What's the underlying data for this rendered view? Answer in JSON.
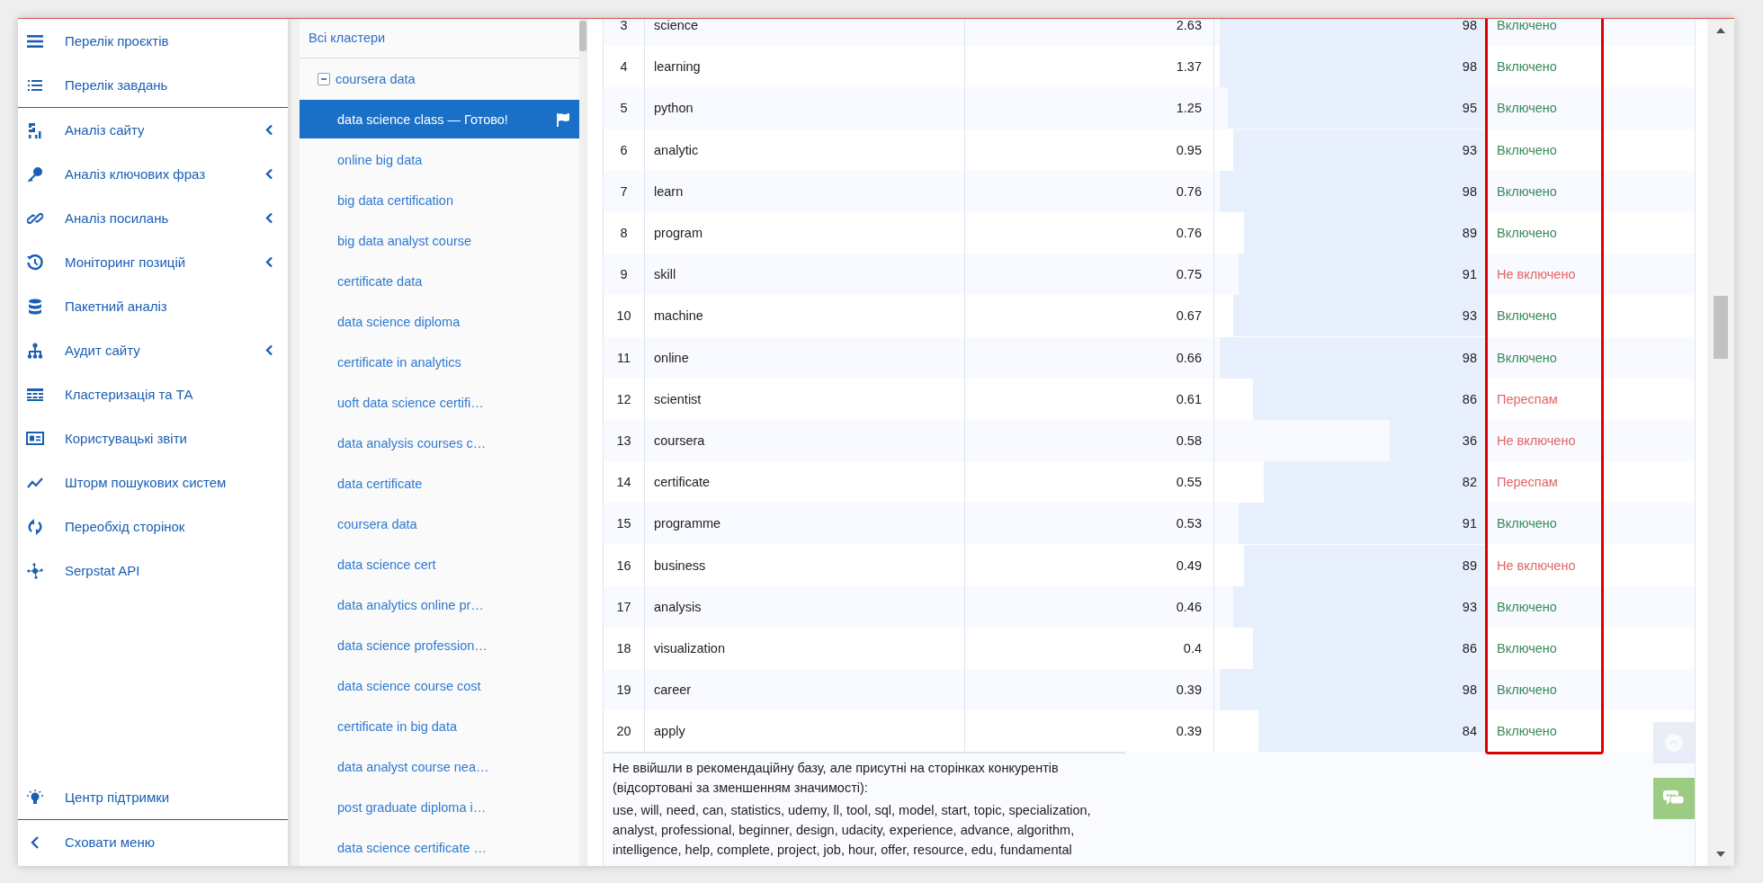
{
  "sidebar": {
    "sections": [
      {
        "items": [
          {
            "label": "Перелік проєктів",
            "has_submenu": false
          },
          {
            "label": "Перелік завдань",
            "has_submenu": false
          }
        ]
      },
      {
        "items": [
          {
            "label": "Аналіз сайту",
            "has_submenu": true
          },
          {
            "label": "Аналіз ключових фраз",
            "has_submenu": true
          },
          {
            "label": "Аналіз посилань",
            "has_submenu": true
          },
          {
            "label": "Моніторинг позицій",
            "has_submenu": true
          },
          {
            "label": "Пакетний аналіз",
            "has_submenu": false
          },
          {
            "label": "Аудит сайту",
            "has_submenu": true
          },
          {
            "label": "Кластеризація та ТА",
            "has_submenu": false
          },
          {
            "label": "Користувацькі звіти",
            "has_submenu": false
          },
          {
            "label": "Шторм пошукових систем",
            "has_submenu": false
          },
          {
            "label": "Переобхід сторінок",
            "has_submenu": false
          },
          {
            "label": "Serpstat API",
            "has_submenu": false
          }
        ]
      }
    ],
    "footer": [
      {
        "label": "Центр підтримки"
      },
      {
        "label": "Сховати меню"
      }
    ]
  },
  "clusters": {
    "header": "Всі кластери",
    "tree": [
      {
        "label": "coursera data",
        "expanded": true,
        "children": [
          {
            "label": "data science class — Готово!",
            "selected": true
          },
          {
            "label": "online big data",
            "selected": false
          },
          {
            "label": "big data certification",
            "selected": false
          },
          {
            "label": "big data analyst course",
            "selected": false
          },
          {
            "label": "certificate data",
            "selected": false
          },
          {
            "label": "data science diploma",
            "selected": false
          },
          {
            "label": "certificate in analytics",
            "selected": false
          },
          {
            "label": "uoft data science certifi…",
            "selected": false
          },
          {
            "label": "data analysis courses c…",
            "selected": false
          },
          {
            "label": "data certificate",
            "selected": false
          },
          {
            "label": "coursera data",
            "selected": false
          },
          {
            "label": "data science cert",
            "selected": false
          },
          {
            "label": "data analytics online pr…",
            "selected": false
          },
          {
            "label": "data science profession…",
            "selected": false
          },
          {
            "label": "data science course cost",
            "selected": false
          },
          {
            "label": "certificate in big data",
            "selected": false
          },
          {
            "label": "data analyst course nea…",
            "selected": false
          },
          {
            "label": "post graduate diploma i…",
            "selected": false
          },
          {
            "label": "data science certificate …",
            "selected": false
          }
        ]
      }
    ]
  },
  "table": {
    "rows": [
      {
        "num": "3",
        "word": "science",
        "value": "2.63",
        "score": "98",
        "level": 0.98,
        "status": "Включено",
        "kind": "included"
      },
      {
        "num": "4",
        "word": "learning",
        "value": "1.37",
        "score": "98",
        "level": 0.98,
        "status": "Включено",
        "kind": "included"
      },
      {
        "num": "5",
        "word": "python",
        "value": "1.25",
        "score": "95",
        "level": 0.95,
        "status": "Включено",
        "kind": "included"
      },
      {
        "num": "6",
        "word": "analytic",
        "value": "0.95",
        "score": "93",
        "level": 0.93,
        "status": "Включено",
        "kind": "included"
      },
      {
        "num": "7",
        "word": "learn",
        "value": "0.76",
        "score": "98",
        "level": 0.98,
        "status": "Включено",
        "kind": "included"
      },
      {
        "num": "8",
        "word": "program",
        "value": "0.76",
        "score": "89",
        "level": 0.89,
        "status": "Включено",
        "kind": "included"
      },
      {
        "num": "9",
        "word": "skill",
        "value": "0.75",
        "score": "91",
        "level": 0.91,
        "status": "Не включено",
        "kind": "excluded"
      },
      {
        "num": "10",
        "word": "machine",
        "value": "0.67",
        "score": "93",
        "level": 0.93,
        "status": "Включено",
        "kind": "included"
      },
      {
        "num": "11",
        "word": "online",
        "value": "0.66",
        "score": "98",
        "level": 0.98,
        "status": "Включено",
        "kind": "included"
      },
      {
        "num": "12",
        "word": "scientist",
        "value": "0.61",
        "score": "86",
        "level": 0.86,
        "status": "Переспам",
        "kind": "spam"
      },
      {
        "num": "13",
        "word": "coursera",
        "value": "0.58",
        "score": "36",
        "level": 0.36,
        "status": "Не включено",
        "kind": "excluded"
      },
      {
        "num": "14",
        "word": "certificate",
        "value": "0.55",
        "score": "82",
        "level": 0.82,
        "status": "Переспам",
        "kind": "spam"
      },
      {
        "num": "15",
        "word": "programme",
        "value": "0.53",
        "score": "91",
        "level": 0.91,
        "status": "Включено",
        "kind": "included"
      },
      {
        "num": "16",
        "word": "business",
        "value": "0.49",
        "score": "89",
        "level": 0.89,
        "status": "Не включено",
        "kind": "excluded"
      },
      {
        "num": "17",
        "word": "analysis",
        "value": "0.46",
        "score": "93",
        "level": 0.93,
        "status": "Включено",
        "kind": "included"
      },
      {
        "num": "18",
        "word": "visualization",
        "value": "0.4",
        "score": "86",
        "level": 0.86,
        "status": "Включено",
        "kind": "included"
      },
      {
        "num": "19",
        "word": "career",
        "value": "0.39",
        "score": "98",
        "level": 0.98,
        "status": "Включено",
        "kind": "included"
      },
      {
        "num": "20",
        "word": "apply",
        "value": "0.39",
        "score": "84",
        "level": 0.84,
        "status": "Включено",
        "kind": "included"
      }
    ]
  },
  "note": {
    "caption": "Не ввійшли в рекомендаційну базу, але присутні на сторінках конкурентів (відсортовані за зменшенням значимості):",
    "words": "use, will, need, can, statistics, udemy, ll, tool, sql, model, start, topic, specialization, analyst, professional, beginner, design, udacity, experience, advance, algorithm, intelligence, help, complete, project, job, hour, offer, resource, edu, fundamental"
  }
}
